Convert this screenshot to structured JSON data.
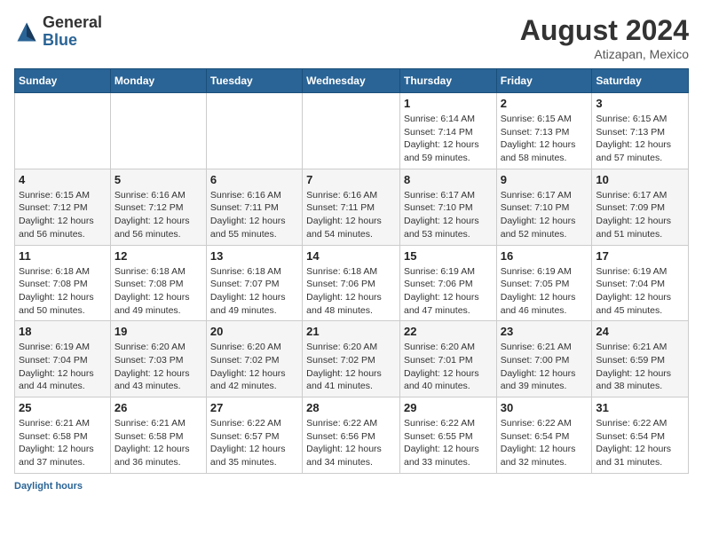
{
  "header": {
    "logo_general": "General",
    "logo_blue": "Blue",
    "month_year": "August 2024",
    "location": "Atizapan, Mexico"
  },
  "days_of_week": [
    "Sunday",
    "Monday",
    "Tuesday",
    "Wednesday",
    "Thursday",
    "Friday",
    "Saturday"
  ],
  "footer": {
    "label": "Daylight hours"
  },
  "weeks": [
    [
      {
        "day": "",
        "sunrise": "",
        "sunset": "",
        "daylight": "",
        "empty": true
      },
      {
        "day": "",
        "sunrise": "",
        "sunset": "",
        "daylight": "",
        "empty": true
      },
      {
        "day": "",
        "sunrise": "",
        "sunset": "",
        "daylight": "",
        "empty": true
      },
      {
        "day": "",
        "sunrise": "",
        "sunset": "",
        "daylight": "",
        "empty": true
      },
      {
        "day": "1",
        "sunrise": "Sunrise: 6:14 AM",
        "sunset": "Sunset: 7:14 PM",
        "daylight": "Daylight: 12 hours and 59 minutes.",
        "empty": false
      },
      {
        "day": "2",
        "sunrise": "Sunrise: 6:15 AM",
        "sunset": "Sunset: 7:13 PM",
        "daylight": "Daylight: 12 hours and 58 minutes.",
        "empty": false
      },
      {
        "day": "3",
        "sunrise": "Sunrise: 6:15 AM",
        "sunset": "Sunset: 7:13 PM",
        "daylight": "Daylight: 12 hours and 57 minutes.",
        "empty": false
      }
    ],
    [
      {
        "day": "4",
        "sunrise": "Sunrise: 6:15 AM",
        "sunset": "Sunset: 7:12 PM",
        "daylight": "Daylight: 12 hours and 56 minutes.",
        "empty": false
      },
      {
        "day": "5",
        "sunrise": "Sunrise: 6:16 AM",
        "sunset": "Sunset: 7:12 PM",
        "daylight": "Daylight: 12 hours and 56 minutes.",
        "empty": false
      },
      {
        "day": "6",
        "sunrise": "Sunrise: 6:16 AM",
        "sunset": "Sunset: 7:11 PM",
        "daylight": "Daylight: 12 hours and 55 minutes.",
        "empty": false
      },
      {
        "day": "7",
        "sunrise": "Sunrise: 6:16 AM",
        "sunset": "Sunset: 7:11 PM",
        "daylight": "Daylight: 12 hours and 54 minutes.",
        "empty": false
      },
      {
        "day": "8",
        "sunrise": "Sunrise: 6:17 AM",
        "sunset": "Sunset: 7:10 PM",
        "daylight": "Daylight: 12 hours and 53 minutes.",
        "empty": false
      },
      {
        "day": "9",
        "sunrise": "Sunrise: 6:17 AM",
        "sunset": "Sunset: 7:10 PM",
        "daylight": "Daylight: 12 hours and 52 minutes.",
        "empty": false
      },
      {
        "day": "10",
        "sunrise": "Sunrise: 6:17 AM",
        "sunset": "Sunset: 7:09 PM",
        "daylight": "Daylight: 12 hours and 51 minutes.",
        "empty": false
      }
    ],
    [
      {
        "day": "11",
        "sunrise": "Sunrise: 6:18 AM",
        "sunset": "Sunset: 7:08 PM",
        "daylight": "Daylight: 12 hours and 50 minutes.",
        "empty": false
      },
      {
        "day": "12",
        "sunrise": "Sunrise: 6:18 AM",
        "sunset": "Sunset: 7:08 PM",
        "daylight": "Daylight: 12 hours and 49 minutes.",
        "empty": false
      },
      {
        "day": "13",
        "sunrise": "Sunrise: 6:18 AM",
        "sunset": "Sunset: 7:07 PM",
        "daylight": "Daylight: 12 hours and 49 minutes.",
        "empty": false
      },
      {
        "day": "14",
        "sunrise": "Sunrise: 6:18 AM",
        "sunset": "Sunset: 7:06 PM",
        "daylight": "Daylight: 12 hours and 48 minutes.",
        "empty": false
      },
      {
        "day": "15",
        "sunrise": "Sunrise: 6:19 AM",
        "sunset": "Sunset: 7:06 PM",
        "daylight": "Daylight: 12 hours and 47 minutes.",
        "empty": false
      },
      {
        "day": "16",
        "sunrise": "Sunrise: 6:19 AM",
        "sunset": "Sunset: 7:05 PM",
        "daylight": "Daylight: 12 hours and 46 minutes.",
        "empty": false
      },
      {
        "day": "17",
        "sunrise": "Sunrise: 6:19 AM",
        "sunset": "Sunset: 7:04 PM",
        "daylight": "Daylight: 12 hours and 45 minutes.",
        "empty": false
      }
    ],
    [
      {
        "day": "18",
        "sunrise": "Sunrise: 6:19 AM",
        "sunset": "Sunset: 7:04 PM",
        "daylight": "Daylight: 12 hours and 44 minutes.",
        "empty": false
      },
      {
        "day": "19",
        "sunrise": "Sunrise: 6:20 AM",
        "sunset": "Sunset: 7:03 PM",
        "daylight": "Daylight: 12 hours and 43 minutes.",
        "empty": false
      },
      {
        "day": "20",
        "sunrise": "Sunrise: 6:20 AM",
        "sunset": "Sunset: 7:02 PM",
        "daylight": "Daylight: 12 hours and 42 minutes.",
        "empty": false
      },
      {
        "day": "21",
        "sunrise": "Sunrise: 6:20 AM",
        "sunset": "Sunset: 7:02 PM",
        "daylight": "Daylight: 12 hours and 41 minutes.",
        "empty": false
      },
      {
        "day": "22",
        "sunrise": "Sunrise: 6:20 AM",
        "sunset": "Sunset: 7:01 PM",
        "daylight": "Daylight: 12 hours and 40 minutes.",
        "empty": false
      },
      {
        "day": "23",
        "sunrise": "Sunrise: 6:21 AM",
        "sunset": "Sunset: 7:00 PM",
        "daylight": "Daylight: 12 hours and 39 minutes.",
        "empty": false
      },
      {
        "day": "24",
        "sunrise": "Sunrise: 6:21 AM",
        "sunset": "Sunset: 6:59 PM",
        "daylight": "Daylight: 12 hours and 38 minutes.",
        "empty": false
      }
    ],
    [
      {
        "day": "25",
        "sunrise": "Sunrise: 6:21 AM",
        "sunset": "Sunset: 6:58 PM",
        "daylight": "Daylight: 12 hours and 37 minutes.",
        "empty": false
      },
      {
        "day": "26",
        "sunrise": "Sunrise: 6:21 AM",
        "sunset": "Sunset: 6:58 PM",
        "daylight": "Daylight: 12 hours and 36 minutes.",
        "empty": false
      },
      {
        "day": "27",
        "sunrise": "Sunrise: 6:22 AM",
        "sunset": "Sunset: 6:57 PM",
        "daylight": "Daylight: 12 hours and 35 minutes.",
        "empty": false
      },
      {
        "day": "28",
        "sunrise": "Sunrise: 6:22 AM",
        "sunset": "Sunset: 6:56 PM",
        "daylight": "Daylight: 12 hours and 34 minutes.",
        "empty": false
      },
      {
        "day": "29",
        "sunrise": "Sunrise: 6:22 AM",
        "sunset": "Sunset: 6:55 PM",
        "daylight": "Daylight: 12 hours and 33 minutes.",
        "empty": false
      },
      {
        "day": "30",
        "sunrise": "Sunrise: 6:22 AM",
        "sunset": "Sunset: 6:54 PM",
        "daylight": "Daylight: 12 hours and 32 minutes.",
        "empty": false
      },
      {
        "day": "31",
        "sunrise": "Sunrise: 6:22 AM",
        "sunset": "Sunset: 6:54 PM",
        "daylight": "Daylight: 12 hours and 31 minutes.",
        "empty": false
      }
    ]
  ]
}
